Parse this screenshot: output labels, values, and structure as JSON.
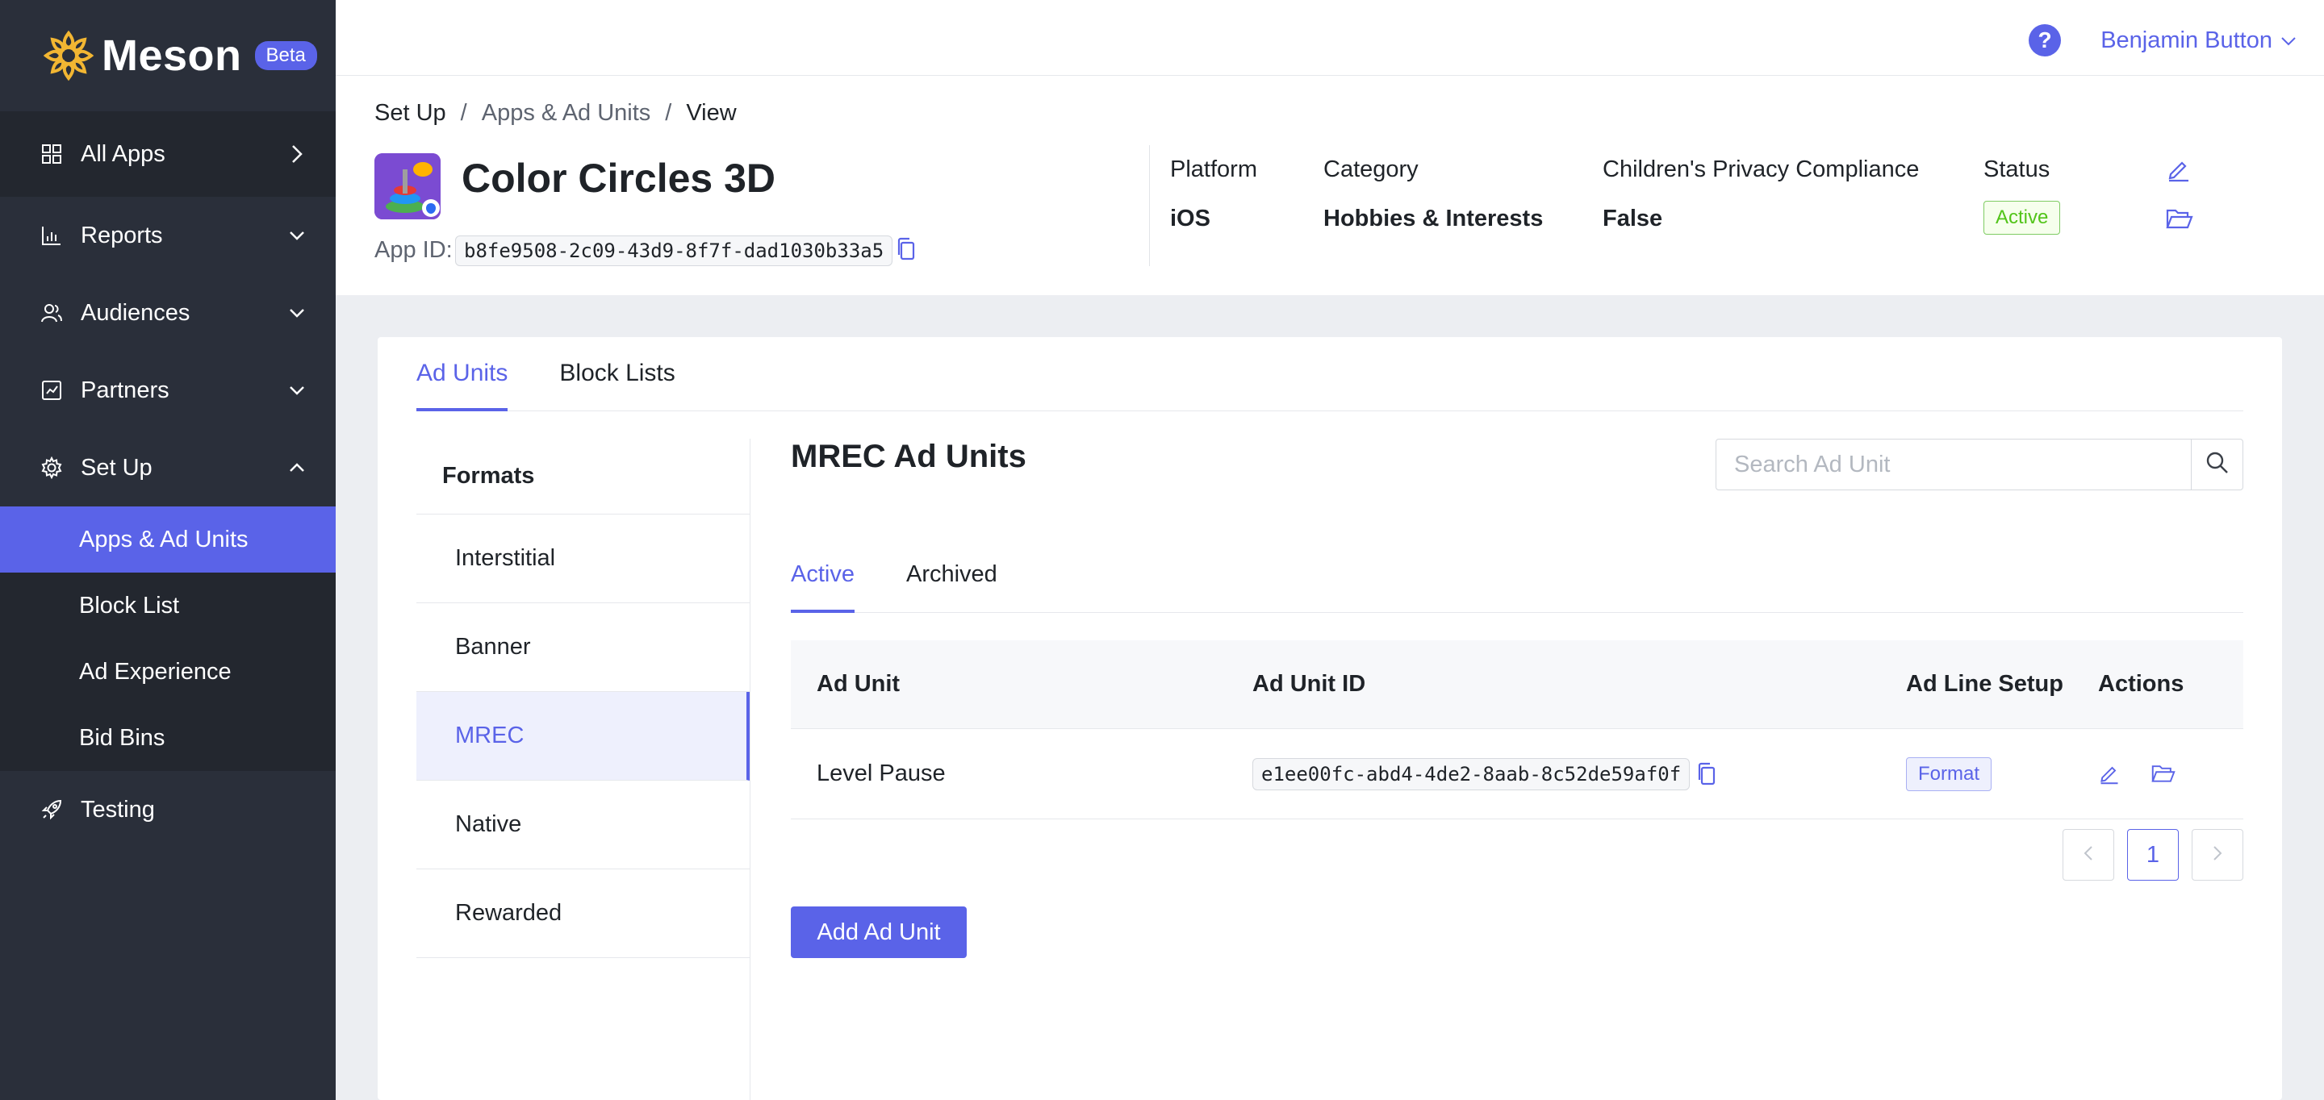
{
  "brand": {
    "name": "Meson",
    "badge": "Beta"
  },
  "sidebar": {
    "items": [
      {
        "label": "All Apps"
      },
      {
        "label": "Reports"
      },
      {
        "label": "Audiences"
      },
      {
        "label": "Partners"
      },
      {
        "label": "Set Up"
      },
      {
        "label": "Testing"
      }
    ],
    "setup_sub": [
      {
        "label": "Apps & Ad Units"
      },
      {
        "label": "Block List"
      },
      {
        "label": "Ad Experience"
      },
      {
        "label": "Bid Bins"
      }
    ]
  },
  "topbar": {
    "help": "?",
    "user_name": "Benjamin Button"
  },
  "breadcrumb": {
    "first": "Set Up",
    "second": "Apps & Ad Units",
    "third": "View",
    "sep": "/"
  },
  "app": {
    "title": "Color Circles 3D",
    "id_label": "App ID:",
    "id_value": "b8fe9508-2c09-43d9-8f7f-dad1030b33a5",
    "platform_label": "Platform",
    "platform_value": "iOS",
    "category_label": "Category",
    "category_value": "Hobbies & Interests",
    "privacy_label": "Children's Privacy Compliance",
    "privacy_value": "False",
    "status_label": "Status",
    "status_value": "Active"
  },
  "tabs": {
    "ad_units": "Ad Units",
    "block_lists": "Block Lists"
  },
  "formats": {
    "heading": "Formats",
    "items": [
      "Interstitial",
      "Banner",
      "MREC",
      "Native",
      "Rewarded"
    ]
  },
  "panel": {
    "title": "MREC Ad Units",
    "search_placeholder": "Search Ad Unit",
    "subtab_active": "Active",
    "subtab_archived": "Archived"
  },
  "table": {
    "headers": [
      "Ad Unit",
      "Ad Unit ID",
      "Ad Line Setup",
      "Actions"
    ],
    "rows": [
      {
        "name": "Level Pause",
        "id": "e1ee00fc-abd4-4de2-8aab-8c52de59af0f",
        "setup": "Format"
      }
    ]
  },
  "pager": {
    "current": "1"
  },
  "add_button": "Add Ad Unit",
  "colors": {
    "accent": "#5a63e8",
    "sidebar": "#2a2f3a",
    "active_status": "#52c41a"
  }
}
